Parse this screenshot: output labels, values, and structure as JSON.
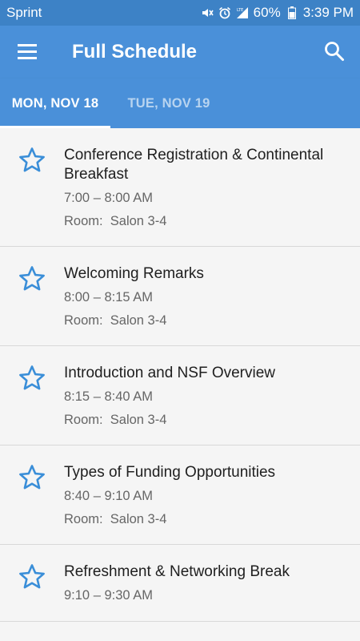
{
  "status_bar": {
    "carrier": "Sprint",
    "battery": "60%",
    "time": "3:39 PM",
    "icons": [
      "mute-icon",
      "alarm-icon",
      "lte-signal-icon",
      "battery-icon"
    ]
  },
  "app_bar": {
    "title": "Full Schedule",
    "menu_icon": "hamburger-menu-icon",
    "search_icon": "search-icon"
  },
  "tabs": [
    {
      "label": "MON, NOV 18",
      "active": true
    },
    {
      "label": "TUE, NOV 19",
      "active": false
    }
  ],
  "colors": {
    "primary": "#4a90d9",
    "status_bar": "#3d82c6",
    "star": "#3a8ed8"
  },
  "sessions": [
    {
      "title": "Conference Registration & Continental Breakfast",
      "time": "7:00 – 8:00 AM",
      "room": "Room:  Salon 3-4"
    },
    {
      "title": "Welcoming Remarks",
      "time": "8:00 – 8:15 AM",
      "room": "Room:  Salon 3-4"
    },
    {
      "title": "Introduction and NSF Overview",
      "time": "8:15 – 8:40 AM",
      "room": "Room:  Salon 3-4"
    },
    {
      "title": "Types of Funding Opportunities",
      "time": "8:40 – 9:10 AM",
      "room": "Room:  Salon 3-4"
    },
    {
      "title": "Refreshment & Networking Break",
      "time": "9:10 – 9:30 AM",
      "room": ""
    }
  ]
}
